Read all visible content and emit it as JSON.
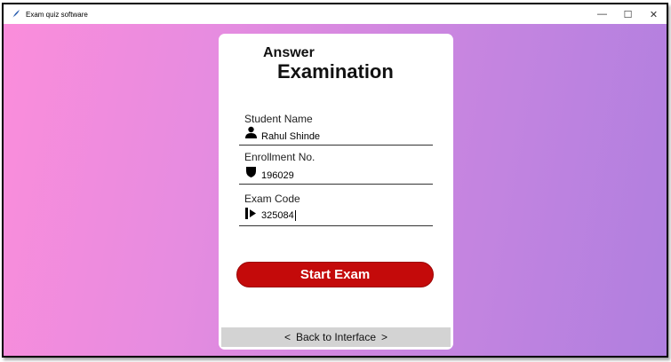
{
  "window": {
    "title": "Exam quiz software",
    "controls": {
      "minimize": "—",
      "maximize": "☐",
      "close": "✕"
    }
  },
  "card": {
    "heading_line1": "Answer",
    "heading_line2": "Examination",
    "fields": [
      {
        "label": "Student Name",
        "value": "Rahul Shinde",
        "icon": "user-icon"
      },
      {
        "label": "Enrollment No.",
        "value": "196029",
        "icon": "shield-icon"
      },
      {
        "label": "Exam Code",
        "value": "325084",
        "icon": "login-arrow-icon"
      }
    ],
    "start_button": "Start Exam",
    "back_button": {
      "prefix": "<",
      "label": "Back to Interface",
      "suffix": ">"
    }
  },
  "colors": {
    "gradient_start": "#fb8ddb",
    "gradient_end": "#b07fdf",
    "start_button": "#c40a0a",
    "back_button": "#d3d3d3"
  }
}
